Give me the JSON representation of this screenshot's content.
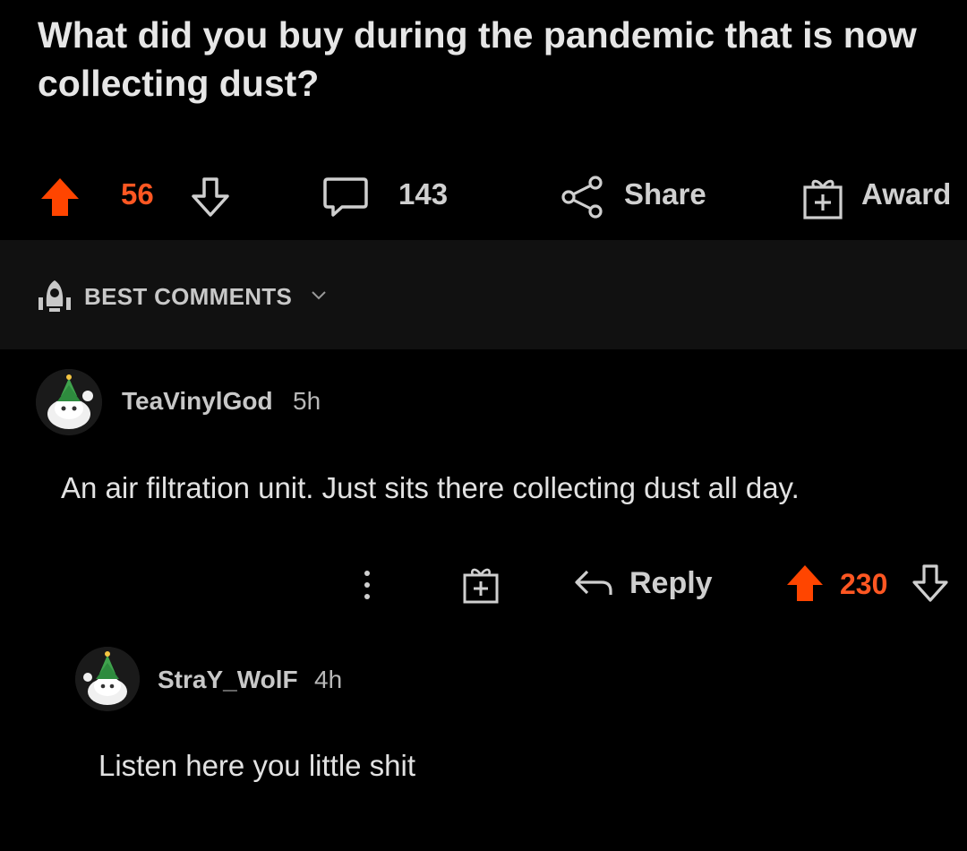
{
  "post": {
    "title": "What did you buy during the pandemic that is now collecting dust?",
    "score": "56",
    "comment_count": "143",
    "share_label": "Share",
    "award_label": "Award"
  },
  "sort": {
    "label": "BEST COMMENTS"
  },
  "comments": [
    {
      "username": "TeaVinylGod",
      "time": "5h",
      "body": "An air filtration unit. Just sits there collecting dust all day.",
      "reply_label": "Reply",
      "score": "230"
    },
    {
      "username": "StraY_WolF",
      "time": "4h",
      "body": "Listen here you little shit"
    }
  ],
  "colors": {
    "background": "#000000",
    "upvote_active": "#ff4500",
    "score_active": "#ff5722",
    "sort_bar_bg": "#111111",
    "text": "#d7dadc"
  },
  "icons": {
    "upvote": "upvote-arrow-icon",
    "downvote": "downvote-arrow-icon",
    "comment": "speech-bubble-icon",
    "share": "share-nodes-icon",
    "award": "gift-box-icon",
    "sort": "rocket-icon",
    "more": "vertical-dots-icon",
    "reply": "reply-arrow-icon"
  }
}
